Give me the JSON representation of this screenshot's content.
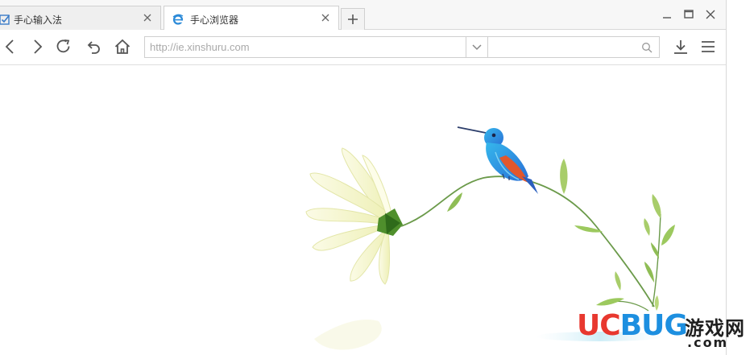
{
  "tabs": [
    {
      "title": "手心输入法",
      "icon": "checkbox-app-icon",
      "active": false
    },
    {
      "title": "手心浏览器",
      "icon": "ie-browser-icon",
      "active": true
    }
  ],
  "newtab_icon": "plus-icon",
  "window_controls": [
    "minimize-icon",
    "maximize-icon",
    "close-icon"
  ],
  "toolbar": {
    "buttons": [
      "back-icon",
      "forward-icon",
      "refresh-icon",
      "undo-icon",
      "home-icon"
    ],
    "address_placeholder": "http://ie.xinshuru.com",
    "address_value": "",
    "search_placeholder": "",
    "right_buttons": [
      "download-icon",
      "menu-icon"
    ]
  },
  "watermark": {
    "brand_part1": "UC",
    "brand_part2": "BUG",
    "site_cn": "游戏网",
    "domain": ".com",
    "colors": {
      "uc": "#e8382f",
      "bug": "#1d8fe0"
    }
  },
  "colors": {
    "tab_bar": "#f7f7f7",
    "active_tab": "#ffffff",
    "border": "#d0d0d0",
    "icon": "#555555",
    "ie_blue": "#2b8ad8"
  }
}
